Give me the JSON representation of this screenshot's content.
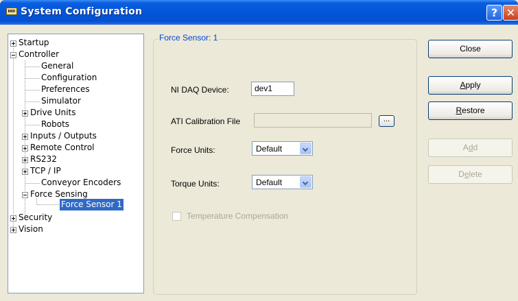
{
  "window": {
    "title": "System Configuration",
    "help_label": "?",
    "close_label": "✕"
  },
  "tree": {
    "startup": "Startup",
    "controller": "Controller",
    "general": "General",
    "configuration": "Configuration",
    "preferences": "Preferences",
    "simulator": "Simulator",
    "drive_units": "Drive Units",
    "robots": "Robots",
    "inputs_outputs": "Inputs / Outputs",
    "remote_control": "Remote Control",
    "rs232": "RS232",
    "tcp_ip": "TCP / IP",
    "conveyor_encoders": "Conveyor Encoders",
    "force_sensing": "Force Sensing",
    "force_sensor_1": "Force Sensor 1",
    "security": "Security",
    "vision": "Vision"
  },
  "panel": {
    "group_title": "Force Sensor: 1",
    "ni_daq_label": "NI DAQ Device:",
    "ni_daq_value": "dev1",
    "ati_label": "ATI Calibration File",
    "ati_value": "",
    "browse_label": "...",
    "force_units_label": "Force Units:",
    "force_units_value": "Default",
    "torque_units_label": "Torque Units:",
    "torque_units_value": "Default",
    "temp_comp_label": "Temperature Compensation",
    "temp_comp_checked": false
  },
  "buttons": {
    "close": "Close",
    "apply_u": "A",
    "apply_rest": "pply",
    "restore_u": "R",
    "restore_rest": "estore",
    "add_a": "A",
    "add_u": "d",
    "add_rest": "d",
    "delete_a": "D",
    "delete_u": "e",
    "delete_rest": "lete"
  }
}
